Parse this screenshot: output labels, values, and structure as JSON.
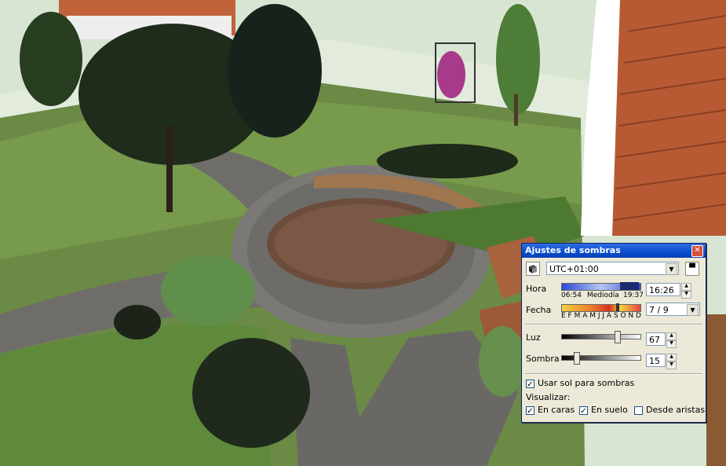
{
  "dialog": {
    "title": "Ajustes de sombras",
    "timezone": "UTC+01:00",
    "hora": {
      "label": "Hora",
      "start_label": "06:54",
      "mid_label": "Mediodía",
      "end_label": "19:37",
      "value": "16:26",
      "slider_fraction": 0.74
    },
    "fecha": {
      "label": "Fecha",
      "months_label": "E F M A M J J A S O N D",
      "value": "7 / 9",
      "slider_fraction": 0.69
    },
    "luz": {
      "label": "Luz",
      "value": "67",
      "slider_fraction": 0.67
    },
    "sombra": {
      "label": "Sombra",
      "value": "15",
      "slider_fraction": 0.15
    },
    "use_sun": {
      "label": "Usar sol para sombras",
      "checked": true
    },
    "visualizar_label": "Visualizar:",
    "en_caras": {
      "label": "En caras",
      "checked": true
    },
    "en_suelo": {
      "label": "En suelo",
      "checked": true
    },
    "desde_aristas": {
      "label": "Desde aristas",
      "checked": false
    }
  }
}
